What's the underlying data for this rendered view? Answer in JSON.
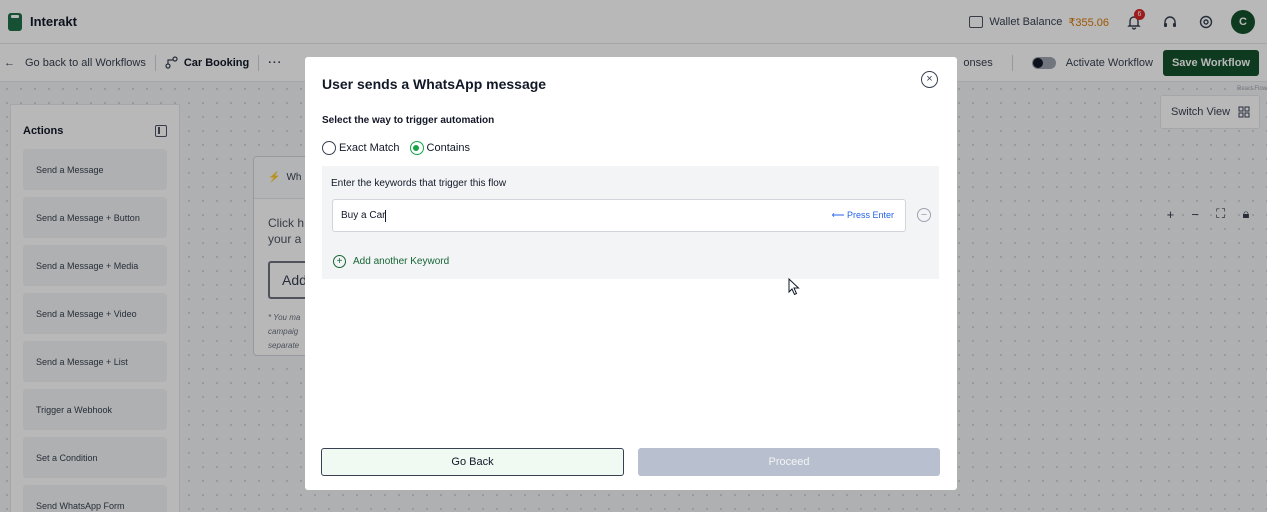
{
  "topbar": {
    "brand": "Interakt",
    "wallet_label": "Wallet Balance",
    "wallet_amount": "₹355.06",
    "notification_count": "6",
    "avatar_initial": "C"
  },
  "subbar": {
    "back_label": "Go back to all Workflows",
    "workflow_name": "Car Booking",
    "more": "···",
    "partial_link": "onses",
    "activate_label": "Activate Workflow",
    "save_label": "Save Workflow",
    "react_flow": "React Flow"
  },
  "sidebar": {
    "title": "Actions",
    "items": [
      {
        "label": "Send a Message"
      },
      {
        "label": "Send a Message + Button"
      },
      {
        "label": "Send a Message + Media"
      },
      {
        "label": "Send a Message + Video"
      },
      {
        "label": "Send a Message + List"
      },
      {
        "label": "Trigger a Webhook"
      },
      {
        "label": "Set a Condition"
      },
      {
        "label": "Send WhatsApp Form"
      }
    ]
  },
  "node": {
    "head": "Wh",
    "text_line1": "Click h",
    "text_line2": "your a",
    "add": "Add",
    "note_line1": "* You ma",
    "note_line2": "campaig",
    "note_line3": "separate"
  },
  "canvas": {
    "switch_view": "Switch View",
    "zoom_in": "+",
    "zoom_out": "−"
  },
  "modal": {
    "title": "User sends a WhatsApp message",
    "select_label": "Select the way to trigger automation",
    "options": [
      "Exact Match",
      "Contains"
    ],
    "selected_option": "Contains",
    "keywords_label": "Enter the keywords that trigger this flow",
    "keyword_value": "Buy a Car",
    "press_enter": "⟵ Press Enter",
    "add_keyword": "Add another Keyword",
    "go_back": "Go Back",
    "proceed": "Proceed"
  }
}
